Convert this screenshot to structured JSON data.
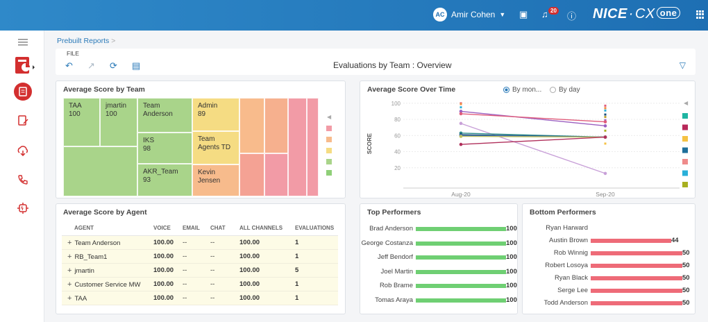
{
  "header": {
    "user_initials": "AC",
    "user_name": "Amir Cohen",
    "notification_count": "20",
    "brand_nice": "NICE",
    "brand_cx": "CX",
    "brand_one": "one",
    "color": "#1e6fb3"
  },
  "breadcrumb": {
    "label": "Prebuilt Reports",
    "separator": ">"
  },
  "toolbar": {
    "file_label": "FILE",
    "report_title": "Evaluations by Team : Overview"
  },
  "team_panel": {
    "title": "Average Score by Team",
    "cells": [
      {
        "name": "TAA",
        "score": "100",
        "color": "#a9d48a"
      },
      {
        "name": "jmartin",
        "score": "100",
        "color": "#a9d48a"
      },
      {
        "name": "Team Anderson",
        "score": "",
        "color": "#a9d48a"
      },
      {
        "name": "IKS",
        "score": "98",
        "color": "#a9d48a"
      },
      {
        "name": "AKR_Team",
        "score": "93",
        "color": "#a9d48a"
      },
      {
        "name": "Admin",
        "score": "89",
        "color": "#f5dc83"
      },
      {
        "name": "Team Agents TD",
        "score": "",
        "color": "#f5dc83"
      },
      {
        "name": "Kevin Jensen",
        "score": "",
        "color": "#f7bb8c"
      }
    ],
    "legend_colors": [
      "#f29ba6",
      "#f7bb8c",
      "#f5dc83",
      "#a9d48a",
      "#8fcf78"
    ]
  },
  "time_panel": {
    "title": "Average Score Over Time",
    "option_month": "By mon...",
    "option_day": "By day",
    "selected": "By month"
  },
  "chart_data": {
    "type": "line",
    "x": [
      "Aug-20",
      "Sep-20"
    ],
    "xlabel": "By month",
    "ylabel": "SCORE",
    "ylim": [
      0,
      105
    ],
    "yticks": [
      20,
      40,
      60,
      80,
      100
    ],
    "series": [
      {
        "color": "#9b5fc0",
        "values": [
          90,
          72
        ]
      },
      {
        "color": "#e05b7a",
        "values": [
          87,
          77
        ]
      },
      {
        "color": "#c8a0d8",
        "values": [
          75,
          13
        ]
      },
      {
        "color": "#2a8a8a",
        "values": [
          63,
          58
        ]
      },
      {
        "color": "#1a4f7a",
        "values": [
          61,
          58
        ]
      },
      {
        "color": "#3d6fb0",
        "values": [
          60,
          58
        ]
      },
      {
        "color": "#c0c060",
        "values": [
          59,
          58
        ]
      },
      {
        "color": "#b02f5b",
        "values": [
          49,
          58
        ]
      }
    ],
    "extra_points": [
      {
        "x": "Aug-20",
        "values": [
          100,
          99,
          95
        ]
      },
      {
        "x": "Sep-20",
        "values": [
          97,
          94,
          91,
          86,
          83,
          79,
          66,
          50
        ]
      }
    ],
    "legend_colors": [
      "#1fb5a2",
      "#b8285a",
      "#f5c243",
      "#1e6f9a",
      "#ef8b8b",
      "#2ab0d9",
      "#a8b020"
    ]
  },
  "agent_panel": {
    "title": "Average Score by Agent",
    "columns": [
      "AGENT",
      "VOICE",
      "EMAIL",
      "CHAT",
      "ALL CHANNELS",
      "EVALUATIONS"
    ],
    "rows": [
      [
        "Team Anderson",
        "100.00",
        "--",
        "--",
        "100.00",
        "1"
      ],
      [
        "RB_Team1",
        "100.00",
        "--",
        "--",
        "100.00",
        "1"
      ],
      [
        "jmartin",
        "100.00",
        "--",
        "--",
        "100.00",
        "5"
      ],
      [
        "Customer Service MW",
        "100.00",
        "--",
        "--",
        "100.00",
        "1"
      ],
      [
        "TAA",
        "100.00",
        "--",
        "--",
        "100.00",
        "1"
      ]
    ]
  },
  "top_performers": {
    "title": "Top Performers",
    "bar_color": "#6fcf73",
    "max": 100,
    "rows": [
      {
        "name": "Brad Anderson",
        "value": 100
      },
      {
        "name": "George Costanza",
        "value": 100
      },
      {
        "name": "Jeff Bendorf",
        "value": 100
      },
      {
        "name": "Joel Martin",
        "value": 100
      },
      {
        "name": "Rob Brame",
        "value": 100
      },
      {
        "name": "Tomas Araya",
        "value": 100
      }
    ]
  },
  "bottom_performers": {
    "title": "Bottom Performers",
    "bar_color": "#ee6b78",
    "max": 50,
    "rows": [
      {
        "name": "Ryan Harward",
        "value": null
      },
      {
        "name": "Austin Brown",
        "value": 44
      },
      {
        "name": "Rob Winnig",
        "value": 50
      },
      {
        "name": "Robert Losoya",
        "value": 50
      },
      {
        "name": "Ryan Black",
        "value": 50
      },
      {
        "name": "Serge Lee",
        "value": 50
      },
      {
        "name": "Todd Anderson",
        "value": 50
      }
    ]
  }
}
